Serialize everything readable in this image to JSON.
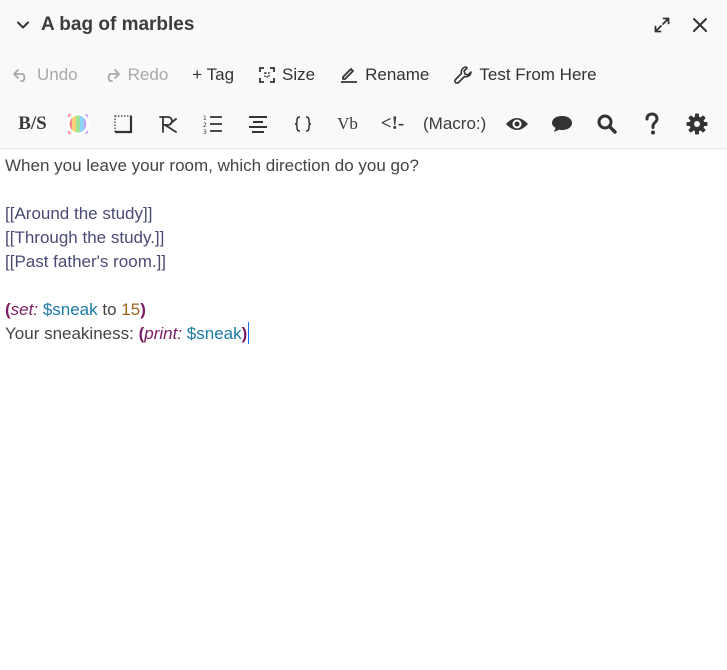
{
  "header": {
    "title": "A bag of marbles"
  },
  "actions": {
    "undo": "Undo",
    "redo": "Redo",
    "tag": "+ Tag",
    "size": "Size",
    "rename": "Rename",
    "test": "Test From Here"
  },
  "toolbar": {
    "bold_strike": "B/S",
    "verbatim": "Vb",
    "comment": "<!-",
    "macro": "(Macro:)"
  },
  "passage": {
    "line1": "When you leave your room, which direction do you go?",
    "link1": "[[Around the study]]",
    "link2": "[[Through the study.]]",
    "link3": "[[Past father's room.]]",
    "set_open": "(",
    "set_name": "set:",
    "set_var": "$sneak",
    "set_to": "to",
    "set_num": "15",
    "set_close": ")",
    "print_prefix": "Your sneakiness: ",
    "print_open": "(",
    "print_name": "print:",
    "print_var": "$sneak",
    "print_close": ")"
  },
  "icons": [
    "chevron-down-icon",
    "maximize-icon",
    "close-icon",
    "undo-icon",
    "redo-icon",
    "plus-icon",
    "size-icon",
    "rename-icon",
    "wrench-icon",
    "color-icon",
    "border-icon",
    "align-right-icon",
    "list-icon",
    "center-icon",
    "braces-icon",
    "eye-icon",
    "comment-icon",
    "search-icon",
    "help-icon",
    "gear-icon"
  ]
}
